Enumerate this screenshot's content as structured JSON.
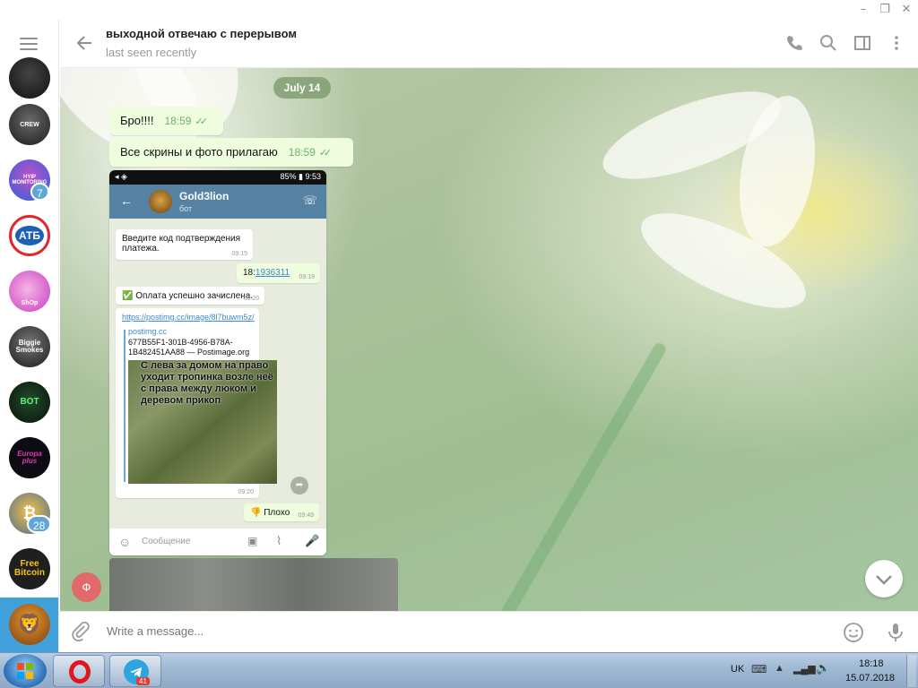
{
  "window": {
    "minimize": "–",
    "restore": "❐",
    "close": "✕"
  },
  "rail": {
    "avatars": [
      {
        "name": "chat-avatar-1",
        "label": ""
      },
      {
        "name": "chat-avatar-crew",
        "label": "CREW"
      },
      {
        "name": "chat-avatar-hyip",
        "label": "HYIP MONITORING",
        "badge": "7"
      },
      {
        "name": "chat-avatar-atb",
        "label": "АТБ"
      },
      {
        "name": "chat-avatar-shop",
        "label": "ShOp"
      },
      {
        "name": "chat-avatar-biggie",
        "label": "Biggie Smokes"
      },
      {
        "name": "chat-avatar-bot",
        "label": "BOT"
      },
      {
        "name": "chat-avatar-europa",
        "label": "Europa plus"
      },
      {
        "name": "chat-avatar-crypto",
        "label": "",
        "badge": "28"
      },
      {
        "name": "chat-avatar-freebitcoin",
        "label": "Free Bitcoin"
      },
      {
        "name": "chat-avatar-lion",
        "label": ""
      }
    ]
  },
  "header": {
    "title": "выходной отвечаю с перерывом",
    "status": "last seen recently"
  },
  "chat": {
    "date": "July 14",
    "messages": [
      {
        "text": "Бро!!!!",
        "time": "18:59"
      },
      {
        "text": "Все скрины и фото прилагаю",
        "time": "18:59"
      }
    ],
    "sender_initial": "Ф"
  },
  "phone": {
    "status_right": "85% ▮ 9:53",
    "bot_name": "Gold3lion",
    "bot_sub": "бот",
    "msg1": "Введите код подтверждения платежа.",
    "msg1_time": "09:15",
    "msg2_prefix": "18:",
    "msg2_link": "1936311",
    "msg2_time": "09:19",
    "msg3": "✅ Оплата успешно зачислена.",
    "msg3_time": "09:20",
    "link": "https://postimg.cc/image/8l7buwm5z/",
    "site": "postimg.cc",
    "preview_title": "677B55F1-301B-4956-B78A-1B482451AA88 — Postimage.org",
    "photo_caption": "С лева за домом на право уходит тропинка возле неё с права между люком и деревом прикоп",
    "msg4_time": "09:20",
    "msg5": "👎 Плохо",
    "msg5_time": "09:49",
    "input_placeholder": "Сообщение"
  },
  "composer": {
    "placeholder": "Write a message..."
  },
  "taskbar": {
    "telegram_badge": "41",
    "lang": "UK",
    "time": "18:18",
    "date": "15.07.2018"
  },
  "colors": {
    "accent": "#419fd9",
    "bubble": "#effdde",
    "phone_bar": "#5682a3"
  }
}
